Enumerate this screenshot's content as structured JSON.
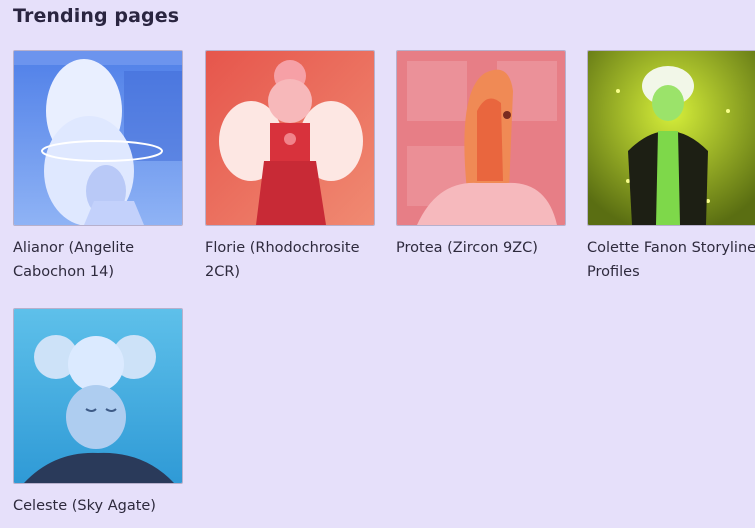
{
  "section": {
    "title": "Trending pages"
  },
  "pages": [
    {
      "label": "Alianor (Angelite Cabochon 14)",
      "thumbnail": "character-portrait-pale-blue"
    },
    {
      "label": "Florie (Rhodochrosite 2CR)",
      "thumbnail": "character-portrait-pink-winged"
    },
    {
      "label": "Protea (Zircon 9ZC)",
      "thumbnail": "character-portrait-orange-pink"
    },
    {
      "label": "Colette Fanon Storyline Profiles",
      "thumbnail": "character-portrait-green"
    },
    {
      "label": "Celeste (Sky Agate)",
      "thumbnail": "character-portrait-sky-blue"
    }
  ],
  "colors": {
    "background": "#e6e0fa",
    "text": "#2e2a3d"
  }
}
